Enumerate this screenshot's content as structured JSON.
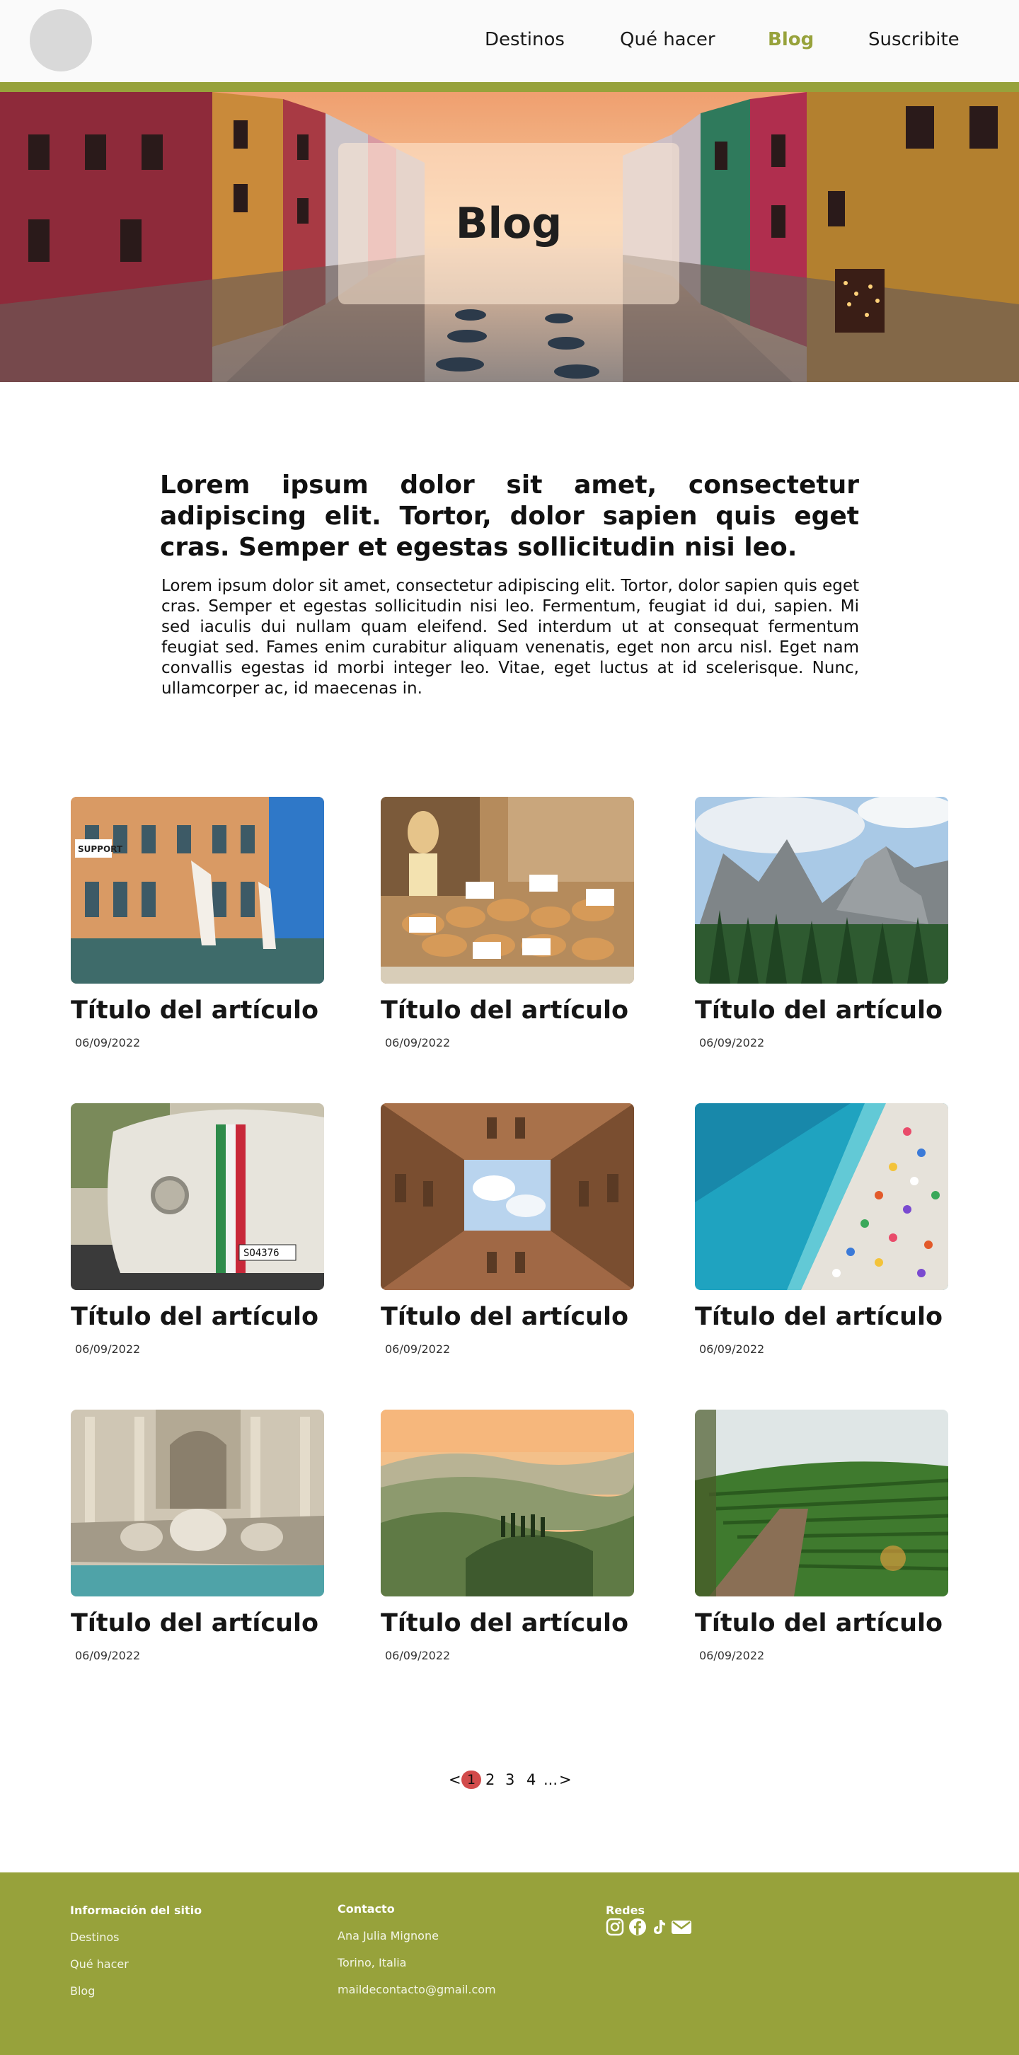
{
  "colors": {
    "accent": "#97a23b",
    "footer_bg": "#97a23b",
    "pagination_current": "#d24b4b",
    "logo_placeholder": "#d9d9d9"
  },
  "header": {
    "logo": "logo-placeholder",
    "nav": [
      {
        "label": "Destinos"
      },
      {
        "label": "Qué hacer"
      },
      {
        "label": "Blog",
        "active": true
      },
      {
        "label": "Suscribite"
      }
    ]
  },
  "hero": {
    "title": "Blog",
    "image": "venice-canal-colorful-houses"
  },
  "intro": {
    "title": "Lorem ipsum dolor sit amet, consectetur adipiscing elit. Tortor, dolor sapien quis eget cras. Semper et egestas sollicitudin nisi leo.",
    "text": "Lorem ipsum dolor sit amet, consectetur adipiscing elit. Tortor, dolor sapien quis eget cras. Semper et egestas sollicitudin nisi leo. Fermentum, feugiat id dui, sapien. Mi sed iaculis dui nullam quam eleifend. Sed interdum ut at consequat fermentum feugiat sed. Fames enim curabitur aliquam venenatis, eget non arcu nisl. Eget nam convallis egestas id morbi integer leo. Vitae, eget luctus at id scelerisque. Nunc, ullamcorper ac, id maecenas in."
  },
  "articles": [
    {
      "title": "Título del artículo",
      "date": "06/09/2022",
      "image": "venice-hands-sculpture"
    },
    {
      "title": "Título del artículo",
      "date": "06/09/2022",
      "image": "bakery-bread"
    },
    {
      "title": "Título del artículo",
      "date": "06/09/2022",
      "image": "dolomites-mountains"
    },
    {
      "title": "Título del artículo",
      "date": "06/09/2022",
      "image": "fiat-500-italian-stripes"
    },
    {
      "title": "Título del artículo",
      "date": "06/09/2022",
      "image": "courtyard-looking-up"
    },
    {
      "title": "Título del artículo",
      "date": "06/09/2022",
      "image": "beach-umbrellas-aerial"
    },
    {
      "title": "Título del artículo",
      "date": "06/09/2022",
      "image": "trevi-fountain"
    },
    {
      "title": "Título del artículo",
      "date": "06/09/2022",
      "image": "tuscany-hills"
    },
    {
      "title": "Título del artículo",
      "date": "06/09/2022",
      "image": "vineyard"
    }
  ],
  "pagination": {
    "prev": "<",
    "pages": [
      "1",
      "2",
      "3",
      "4"
    ],
    "current": 1,
    "ellipsis": "...",
    "next": ">"
  },
  "footer": {
    "site_info": {
      "heading": "Información del sitio",
      "links": [
        "Destinos",
        "Qué hacer",
        "Blog"
      ]
    },
    "contact": {
      "heading": "Contacto",
      "lines": [
        "Ana Julia Mignone",
        "Torino, Italia",
        "maildecontacto@gmail.com"
      ]
    },
    "social": {
      "heading": "Redes",
      "icons": [
        "instagram-icon",
        "facebook-icon",
        "tiktok-icon",
        "mail-icon"
      ]
    }
  }
}
